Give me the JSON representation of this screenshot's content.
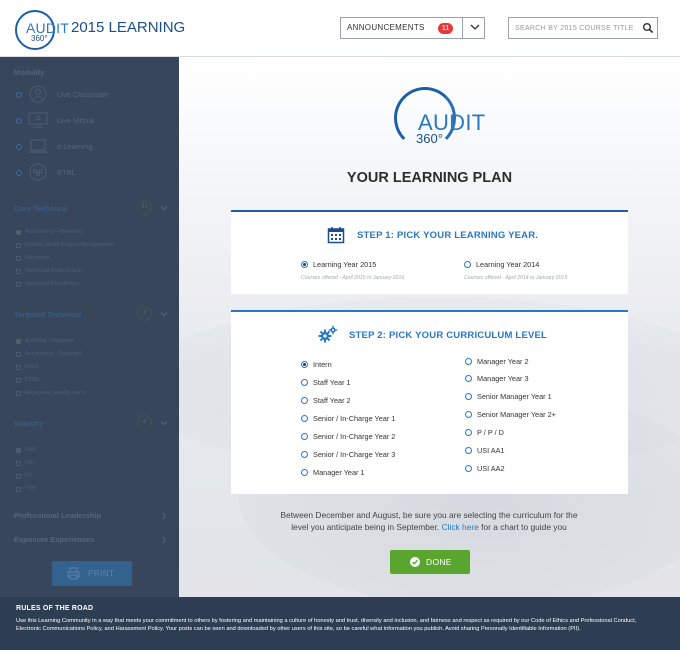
{
  "header": {
    "logo": {
      "audit": "AUDIT",
      "sup": "360°"
    },
    "title": "2015 LEARNING",
    "announcements": {
      "label": "ANNOUNCEMENTS",
      "count": "11"
    },
    "search": {
      "placeholder": "SEARCH BY 2015 COURSE TITLE"
    }
  },
  "sidebar": {
    "modality": {
      "heading": "Modality",
      "items": [
        {
          "label": "Live Classroom",
          "icon": "person-icon"
        },
        {
          "label": "Live Virtual",
          "icon": "monitor-icon"
        },
        {
          "label": "e Learning",
          "icon": "laptop-icon"
        },
        {
          "label": "ETBL",
          "icon": "group-icon"
        }
      ]
    },
    "core_technical": {
      "heading": "Core Technical",
      "count": "31",
      "items": [
        {
          "label": "Accounting - Monetary",
          "checked": true
        },
        {
          "label": "Deloitte Audit Project Management",
          "checked": false
        },
        {
          "label": "Milestone",
          "checked": false
        },
        {
          "label": "Technical Audit Quality",
          "checked": false
        },
        {
          "label": "Technical Excellence",
          "checked": false
        }
      ]
    },
    "targeted_technical": {
      "heading": "Targeted Technical",
      "count": "3",
      "items": [
        {
          "label": "Auditing - Targeted",
          "checked": true
        },
        {
          "label": "Accounting - Targeted",
          "checked": false
        },
        {
          "label": "IFRS",
          "checked": false
        },
        {
          "label": "ETBL",
          "checked": false
        },
        {
          "label": "Employee benefit plans",
          "checked": false
        }
      ]
    },
    "industry": {
      "heading": "Industry",
      "count": "4",
      "items": [
        {
          "label": "FAR",
          "checked": true
        },
        {
          "label": "FSI",
          "checked": false
        },
        {
          "label": "PS",
          "checked": false
        },
        {
          "label": "TMT",
          "checked": false
        }
      ]
    },
    "professional_leadership": "Professional Leadership",
    "exposure_experiences": "Exposure Experiences",
    "print_label": "PRINT"
  },
  "main": {
    "logo": {
      "audit": "AUDIT",
      "sup": "360°"
    },
    "title": "YOUR LEARNING PLAN",
    "step1": {
      "title": "STEP 1:  PICK YOUR LEARNING YEAR.",
      "options": [
        {
          "label": "Learning Year 2015",
          "sub": "Courses offered - April 2015 to January 2016",
          "selected": true
        },
        {
          "label": "Learning Year 2014",
          "sub": "Courses offered - April 2014 to January 2015",
          "selected": false
        }
      ]
    },
    "step2": {
      "title": "STEP 2:  PICK YOUR CURRICULUM LEVEL",
      "left": [
        "Intern",
        "Staff Year 1",
        "Staff Year 2",
        "Senior / In-Charge Year 1",
        "Senior / In-Charge Year 2",
        "Senior / In-Charge Year 3",
        "Manager Year 1"
      ],
      "right": [
        "Manager Year 2",
        "Manager Year 3",
        "Senior Manager Year 1",
        "Senior Manager Year 2+",
        "P / P / D",
        "USI AA1",
        "USI AA2"
      ],
      "selected": "Intern"
    },
    "guide": {
      "line1": "Between December and August, be sure you are  selecting the curriculum for the",
      "line2_prefix": "level you anticipate being in September.",
      "link": "Click here",
      "line2_suffix": "for a chart  to guide you"
    },
    "done_label": "DONE"
  },
  "footer": {
    "title": "RULES OF THE ROAD",
    "text": "Use this Learning Community in a way that meets your commitment to others by fostering and maintaining a culture of honesty and trust, diversity and inclusion, and fairness and respect as required by our Code of Ethics and Professional Conduct, Electronic Communications Policy, and Harassment Policy. Your posts can be seen and downloaded by other users of this site, so be careful what information you publish. Avoid sharing Personally Identifiable Information (PII)."
  },
  "colors": {
    "brand_blue": "#2b78c2",
    "sidebar_bg": "#37465a",
    "footer_bg": "#2d3e52",
    "done_green": "#5aa52d",
    "badge_red": "#e23b3b"
  }
}
